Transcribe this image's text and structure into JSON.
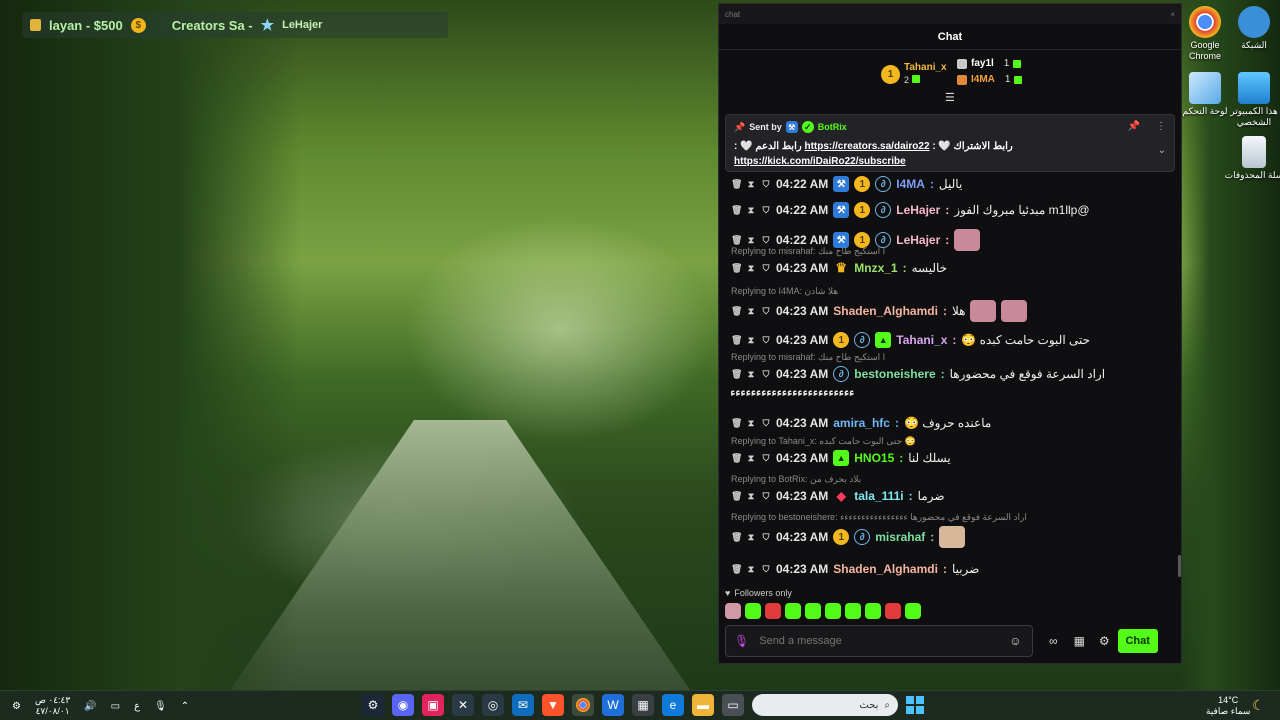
{
  "overlay": {
    "item1": "layan - $500",
    "item2": "Creators Sa -",
    "item3": "LeHajer"
  },
  "desktop_icons": [
    {
      "label": "Google Chrome",
      "icon": "chrome-icon",
      "color": "#e34133"
    },
    {
      "label": "الشبكة",
      "icon": "network-icon",
      "color": "#3a8fd8"
    },
    {
      "label": "لوحة التحكم",
      "icon": "control-panel-icon",
      "color": "#5aa9e6"
    },
    {
      "label": "هذا الكمبيوتر الشخصي",
      "icon": "this-pc-icon",
      "color": "#2c9fe0"
    },
    {
      "label": "سلة المحذوفات",
      "icon": "recycle-bin-icon",
      "color": "#dfe8f0"
    }
  ],
  "chat": {
    "window_title": "chat",
    "close": "×",
    "header": "Chat",
    "leaderboard": {
      "top": {
        "rank": "1",
        "name": "Tahani_x",
        "count": "2"
      },
      "second": {
        "name": "fay1l",
        "count": "1"
      },
      "third": {
        "name": "I4MA",
        "count": "1"
      }
    },
    "pinned": {
      "sent_by": "Sent by",
      "bot": "BotRix",
      "text_prefix": "رابط الدعم 🤍 : ",
      "link1": "https://creators.sa/dairo22",
      "text_mid": " رابط الاشتراك 🤍 :",
      "link2": "https://kick.com/iDaiRo22/subscribe"
    },
    "messages": [
      {
        "time": "04:22 AM",
        "badges": [
          "mod",
          "og",
          "sub"
        ],
        "user": "I4MA",
        "user_color": "#7d9cf5",
        "text": "ياليل",
        "reply": ""
      },
      {
        "time": "04:22 AM",
        "badges": [
          "mod",
          "og",
          "sub"
        ],
        "user": "LeHajer",
        "user_color": "#f7b8c9",
        "text": "@m1llp مبدئيا مبروك الفوز",
        "reply": ""
      },
      {
        "time": "04:22 AM",
        "badges": [
          "mod",
          "og",
          "sub"
        ],
        "user": "LeHajer",
        "user_color": "#f7b8c9",
        "text": "",
        "emote": "cat",
        "reply": ""
      },
      {
        "time": "04:23 AM",
        "badges": [
          "crown"
        ],
        "user": "Mnzx_1",
        "user_color": "#9be36b",
        "text": "خاليسه",
        "reply": "Replying to misrahaf: ا استكيج طاح منك"
      },
      {
        "time": "04:23 AM",
        "badges": [],
        "user": "Shaden_Alghamdi",
        "user_color": "#f5b5a0",
        "text": "هلا",
        "emote": "cat2",
        "reply": "Replying to I4MA: هلا شادن"
      },
      {
        "time": "04:23 AM",
        "badges": [
          "og",
          "sub",
          "kick"
        ],
        "user": "Tahani_x",
        "user_color": "#d8a6f0",
        "text": "حتى البوت حامت كبده 😳",
        "reply": ""
      },
      {
        "time": "04:23 AM",
        "badges": [
          "sub"
        ],
        "user": "bestoneishere",
        "user_color": "#7de0a0",
        "text": "اراد السرعة فوقع في محضورها",
        "extra": "ءءءءءءءءءءءءءءءءءءءءءءءءء",
        "reply": "Replying to misrahaf: ا استكيج طاح منك"
      },
      {
        "time": "04:23 AM",
        "badges": [],
        "user": "amira_hfc",
        "user_color": "#6fb6f5",
        "text": "ماعنده حروف 😳",
        "reply": ""
      },
      {
        "time": "04:23 AM",
        "badges": [
          "kick"
        ],
        "user": "HNO15",
        "user_color": "#53fc18",
        "text": "يسلك لنا",
        "reply": "Replying to Tahani_x: حتى البوت حامت كبده 😳"
      },
      {
        "time": "04:23 AM",
        "badges": [
          "vip"
        ],
        "user": "tala_111i",
        "user_color": "#80e8f0",
        "text": "ضرما",
        "reply": "Replying to BotRix: بلاد بحرف من"
      },
      {
        "time": "04:23 AM",
        "badges": [
          "og",
          "sub"
        ],
        "user": "misrahaf",
        "user_color": "#7de0a0",
        "text": "",
        "emote": "baby",
        "reply": "Replying to bestoneishere: اراد السرعة فوقع في محضورها ءءءءءءءءءءءءءءءء"
      },
      {
        "time": "04:23 AM",
        "badges": [],
        "user": "Shaden_Alghamdi",
        "user_color": "#f5b5a0",
        "text": "ضربيا",
        "reply": ""
      }
    ],
    "followers_only": "Followers only",
    "input_placeholder": "Send a message",
    "send_label": "Chat"
  },
  "taskbar": {
    "clock_time": "٠٤:٤٣ ص",
    "clock_date": "٤٧/٠٨/٠١",
    "lang": "ع",
    "search_placeholder": "بحث",
    "weather_temp": "14°C",
    "weather_desc": "سماء صافية"
  }
}
